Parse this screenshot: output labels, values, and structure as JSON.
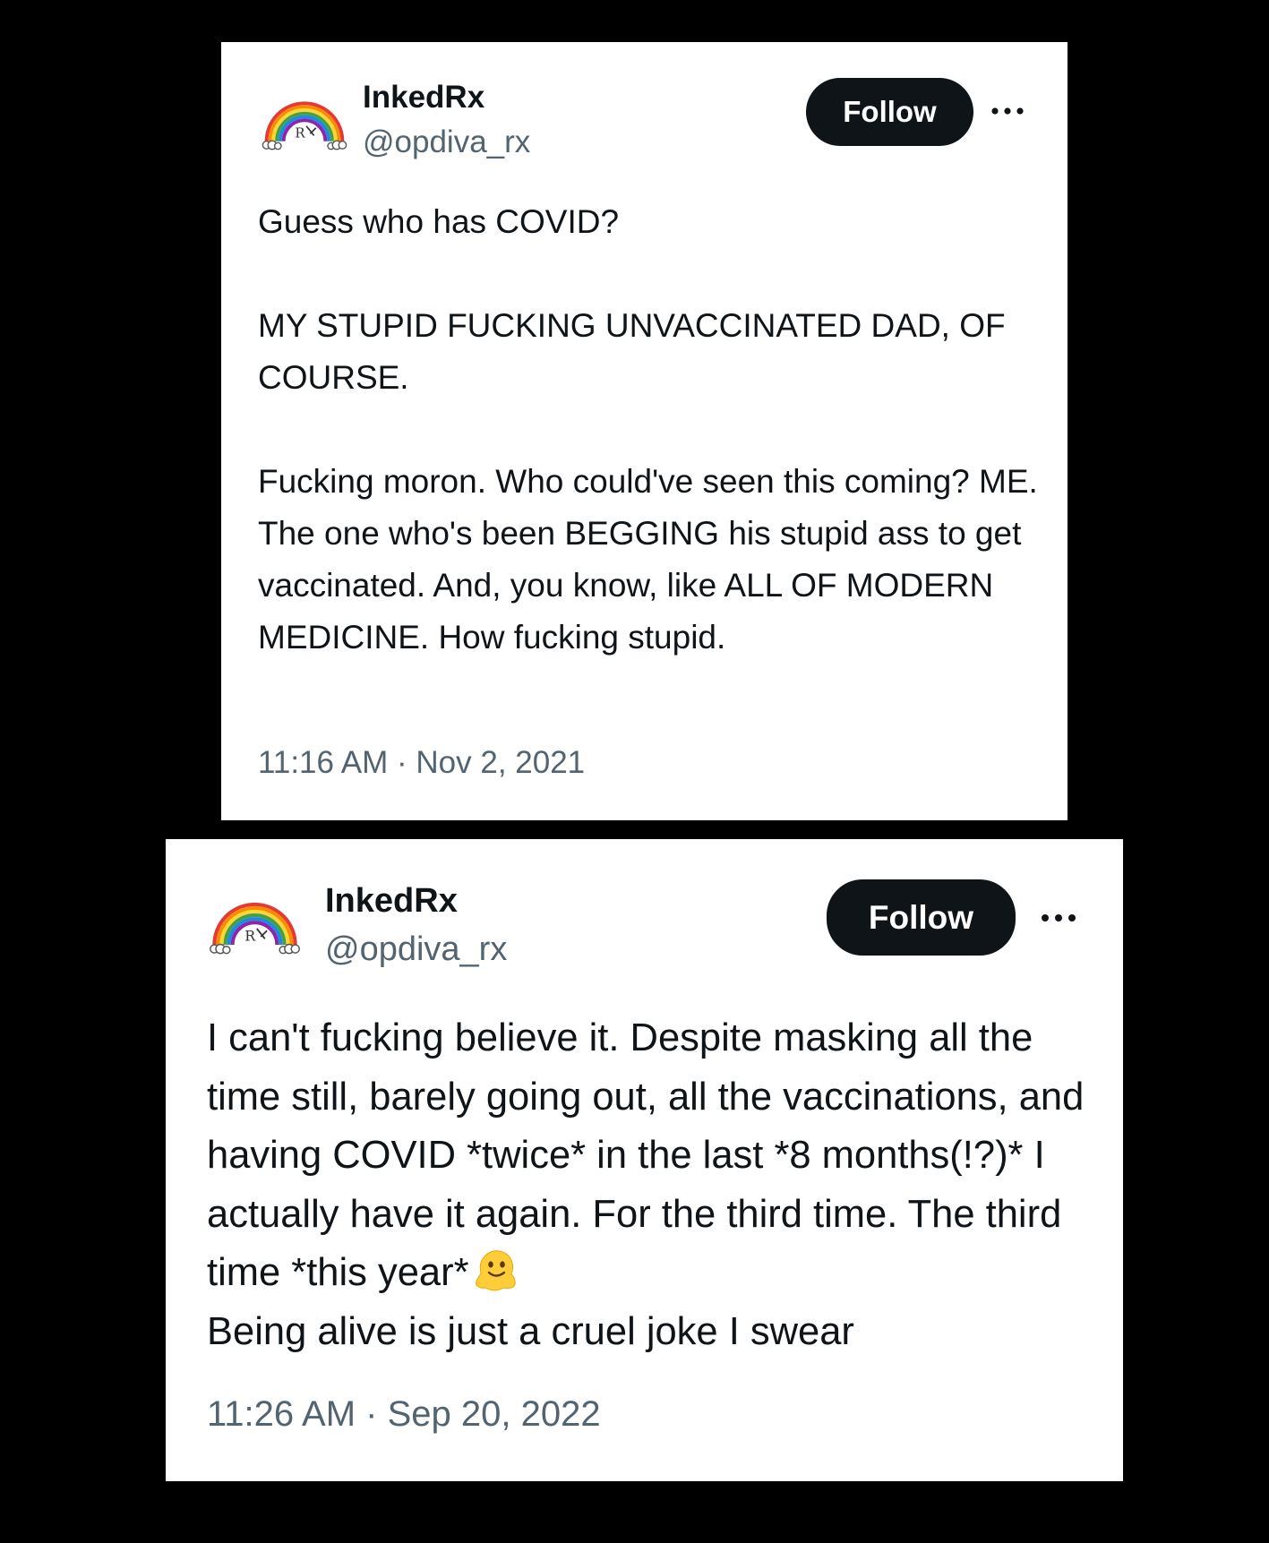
{
  "tweets": [
    {
      "display_name": "InkedRx",
      "handle": "@opdiva_rx",
      "follow_label": "Follow",
      "paragraphs": [
        "Guess who has COVID?",
        "MY STUPID FUCKING UNVACCINATED DAD, OF COURSE.",
        "Fucking moron. Who could've seen this coming? ME. The one who's been BEGGING his stupid ass to get vaccinated. And, you know, like ALL OF MODERN MEDICINE. How fucking stupid."
      ],
      "time": "11:16 AM",
      "separator": " · ",
      "date": "Nov 2, 2021"
    },
    {
      "display_name": "InkedRx",
      "handle": "@opdiva_rx",
      "follow_label": "Follow",
      "text_before_emoji": "I can't fucking believe it. Despite masking all the time still, barely going out, all the vaccinations, and having COVID *twice* in the last *8 months(!?)* I actually have it again. For the third time. The third time *this year*",
      "emoji": "melting-face-emoji",
      "text_after_emoji": "Being alive is just a cruel joke I swear",
      "time": "11:26 AM",
      "separator": " · ",
      "date": "Sep 20, 2022"
    }
  ],
  "colors": {
    "background": "#000000",
    "card": "#ffffff",
    "text_primary": "#0f1419",
    "text_secondary": "#536471",
    "follow_button": "#0f1419"
  },
  "icons": {
    "avatar": "rainbow-rx-logo",
    "more": "more-options-icon"
  }
}
